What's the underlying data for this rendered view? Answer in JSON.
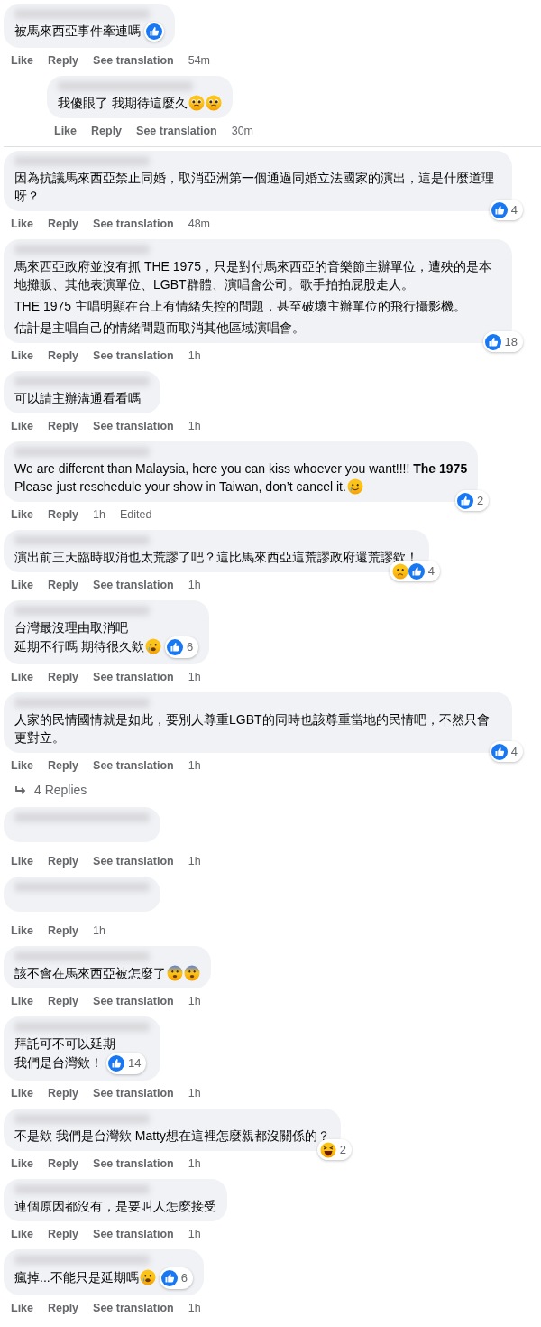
{
  "comments": [
    {
      "paragraphs": [
        "被馬來西亞事件牽連嗎"
      ],
      "inline_badge": true,
      "reactions": [
        {
          "kind": "like"
        }
      ],
      "actions": [
        "Like",
        "Reply",
        "See translation"
      ],
      "time": "54m",
      "replies": [
        {
          "paragraphs": [
            "我傻眼了 我期待這麼久"
          ],
          "emojis": [
            {
              "kind": "pleading"
            },
            {
              "kind": "pleading"
            }
          ],
          "actions": [
            "Like",
            "Reply",
            "See translation"
          ],
          "time": "30m"
        }
      ]
    },
    {
      "separator": true,
      "paragraphs": [
        "因為抗議馬來西亞禁止同婚，取消亞洲第一個通過同婚立法國家的演出，這是什麼道理呀？"
      ],
      "reactions": [
        {
          "kind": "like"
        }
      ],
      "count": "4",
      "actions": [
        "Like",
        "Reply",
        "See translation"
      ],
      "time": "48m"
    },
    {
      "paragraphs": [
        "馬來西亞政府並沒有抓 THE 1975，只是對付馬來西亞的音樂節主辦單位，遭殃的是本地攤販、其他表演單位、LGBT群體、演唱會公司。歌手拍拍屁股走人。",
        "THE 1975 主唱明顯在台上有情緒失控的問題，甚至破壞主辦單位的飛行攝影機。",
        "估計是主唱自己的情緒問題而取消其他區域演唱會。"
      ],
      "reactions": [
        {
          "kind": "like"
        }
      ],
      "count": "18",
      "actions": [
        "Like",
        "Reply",
        "See translation"
      ],
      "time": "1h"
    },
    {
      "paragraphs": [
        "可以請主辦溝通看看嗎"
      ],
      "actions": [
        "Like",
        "Reply",
        "See translation"
      ],
      "time": "1h"
    },
    {
      "lines": [
        "We are different than Malaysia, here you can kiss whoever you want!!!! **The 1975**",
        "Please just reschedule your show in Taiwan, don’t cancel it."
      ],
      "emojis": [
        {
          "kind": "teary"
        }
      ],
      "reactions": [
        {
          "kind": "like"
        }
      ],
      "count": "2",
      "actions": [
        "Like",
        "Reply"
      ],
      "time": "1h",
      "edited": "Edited"
    },
    {
      "paragraphs": [
        "演出前三天臨時取消也太荒謬了吧？這比馬來西亞這荒謬政府還荒謬欸！"
      ],
      "reactions": [
        {
          "kind": "sad"
        },
        {
          "kind": "like"
        }
      ],
      "count": "4",
      "actions": [
        "Like",
        "Reply",
        "See translation"
      ],
      "time": "1h"
    },
    {
      "lines": [
        "台灣最沒理由取消吧",
        "延期不行嗎 期待很久欸"
      ],
      "emojis": [
        {
          "kind": "crying"
        }
      ],
      "inline_badge": true,
      "reactions": [
        {
          "kind": "like"
        }
      ],
      "count": "6",
      "actions": [
        "Like",
        "Reply",
        "See translation"
      ],
      "time": "1h"
    },
    {
      "paragraphs": [
        "人家的民情國情就是如此，要別人尊重LGBT的同時也該尊重當地的民情吧，不然只會更對立。"
      ],
      "reactions": [
        {
          "kind": "like"
        }
      ],
      "count": "4",
      "actions": [
        "Like",
        "Reply",
        "See translation"
      ],
      "time": "1h",
      "more_replies": "4 Replies"
    },
    {
      "actions": [
        "Like",
        "Reply",
        "See translation"
      ],
      "time": "1h"
    },
    {
      "actions": [
        "Like",
        "Reply"
      ],
      "time": "1h"
    },
    {
      "paragraphs": [
        "該不會在馬來西亞被怎麼了"
      ],
      "emojis": [
        {
          "kind": "anxious"
        },
        {
          "kind": "anxious"
        }
      ],
      "actions": [
        "Like",
        "Reply",
        "See translation"
      ],
      "time": "1h"
    },
    {
      "lines": [
        "拜託可不可以延期",
        "我們是台灣欸！"
      ],
      "inline_badge": true,
      "reactions": [
        {
          "kind": "like"
        }
      ],
      "count": "14",
      "actions": [
        "Like",
        "Reply",
        "See translation"
      ],
      "time": "1h"
    },
    {
      "paragraphs": [
        "不是欸 我們是台灣欸 Matty想在這裡怎麼親都沒關係的？"
      ],
      "reactions": [
        {
          "kind": "haha"
        }
      ],
      "count": "2",
      "actions": [
        "Like",
        "Reply",
        "See translation"
      ],
      "time": "1h"
    },
    {
      "paragraphs": [
        "連個原因都沒有，是要叫人怎麼接受"
      ],
      "actions": [
        "Like",
        "Reply",
        "See translation"
      ],
      "time": "1h"
    },
    {
      "paragraphs": [
        "瘋掉...不能只是延期嗎"
      ],
      "emojis": [
        {
          "kind": "crying"
        }
      ],
      "inline_badge": true,
      "reactions": [
        {
          "kind": "like"
        }
      ],
      "count": "6",
      "actions": [
        "Like",
        "Reply",
        "See translation"
      ],
      "time": "1h"
    }
  ]
}
